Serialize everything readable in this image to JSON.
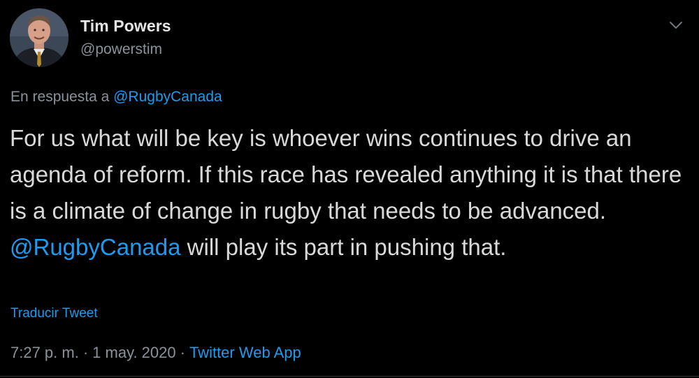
{
  "author": {
    "name": "Tim Powers",
    "handle": "@powerstim"
  },
  "reply": {
    "prefix": "En respuesta a",
    "mention": "@RugbyCanada"
  },
  "tweet": {
    "text_part1": "For us what will be key is whoever wins continues to drive an agenda of reform. If this race has revealed anything it is that there is a climate of change in rugby that needs to be advanced. ",
    "mention": "@RugbyCanada",
    "text_part2": " will play its part in pushing that."
  },
  "translate_label": "Traducir Tweet",
  "meta": {
    "time": "7:27 p. m.",
    "separator": "·",
    "date": "1 may. 2020",
    "source": "Twitter Web App"
  },
  "icons": {
    "menu": "chevron-down-icon"
  },
  "colors": {
    "background": "#000000",
    "text": "#d9d9d9",
    "secondary": "#8b9299",
    "link": "#1d9bf0"
  }
}
